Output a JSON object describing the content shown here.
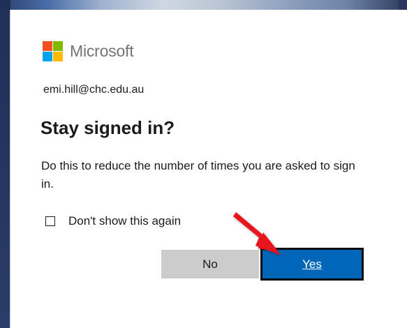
{
  "brand": {
    "name": "Microsoft",
    "squares": [
      "#f25022",
      "#7fba00",
      "#00a4ef",
      "#ffb900"
    ]
  },
  "account": {
    "email": "emi.hill@chc.edu.au"
  },
  "dialog": {
    "title": "Stay signed in?",
    "description": "Do this to reduce the number of times you are asked to sign in.",
    "checkbox": {
      "label": "Don't show this again",
      "checked": false
    },
    "buttons": {
      "no_label": "No",
      "yes_label": "Yes"
    }
  },
  "annotation": {
    "arrow_color": "#e8141b"
  },
  "colors": {
    "primary_button": "#0067b8",
    "secondary_button": "#cccccc"
  }
}
